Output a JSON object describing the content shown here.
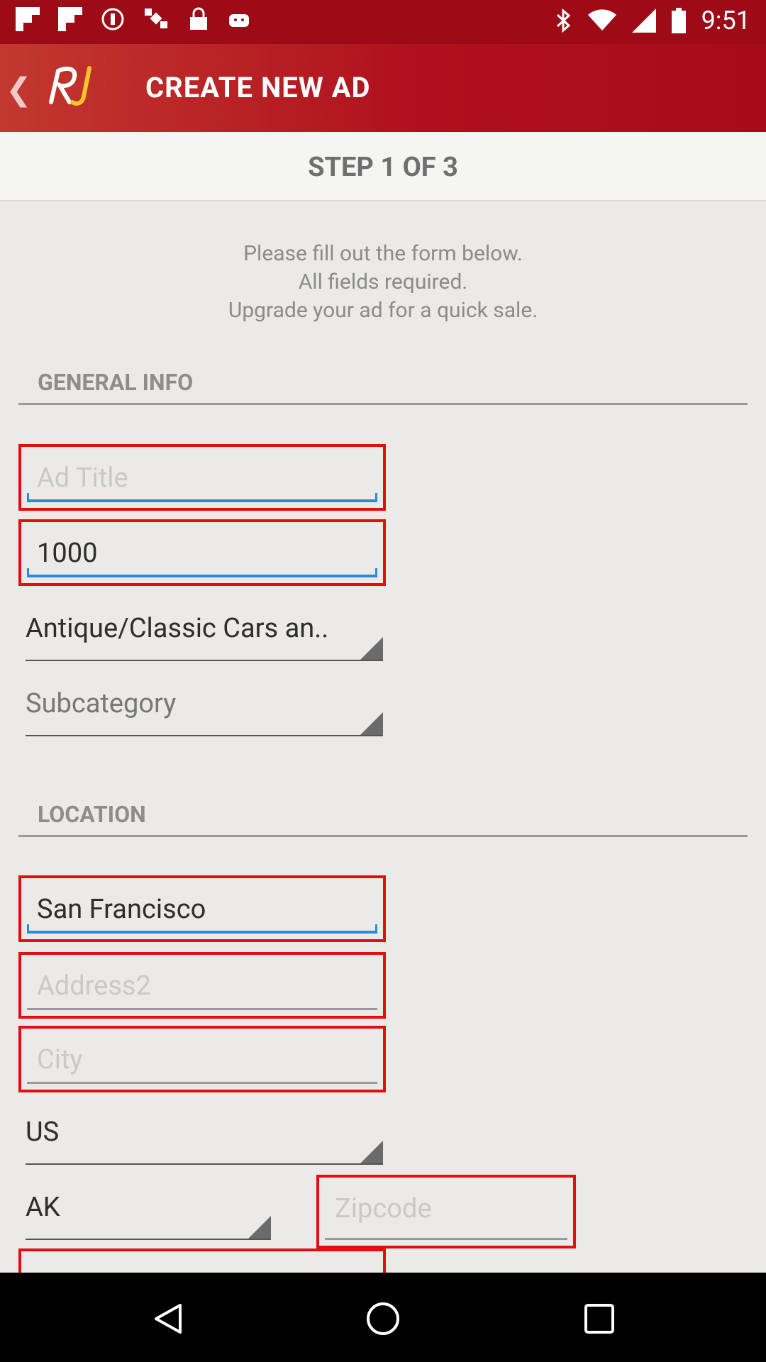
{
  "statusbar": {
    "time": "9:51",
    "left_icons": [
      "flipboard-icon",
      "flipboard-icon",
      "podcast-icon",
      "satellite-icon",
      "lock-icon",
      "android-icon"
    ],
    "right_icons": [
      "bluetooth-icon",
      "wifi-icon",
      "signal-icon",
      "battery-icon"
    ]
  },
  "appbar": {
    "title": "CREATE NEW AD",
    "logo_text": "RJ"
  },
  "step": {
    "label": "STEP 1 OF 3"
  },
  "instructions": [
    "Please fill out the form below.",
    "All fields required.",
    "Upgrade your ad for a quick sale."
  ],
  "general": {
    "header": "GENERAL INFO",
    "ad_title": {
      "value": "",
      "placeholder": "Ad Title"
    },
    "price": {
      "value": "1000",
      "placeholder": ""
    },
    "category": "Antique/Classic Cars an..",
    "subcategory": "Subcategory"
  },
  "location": {
    "header": "LOCATION",
    "address1": {
      "value": "San Francisco",
      "placeholder": ""
    },
    "address2": {
      "value": "",
      "placeholder": "Address2"
    },
    "city": {
      "value": "",
      "placeholder": "City"
    },
    "country": "US",
    "state": "AK",
    "zipcode": {
      "value": "",
      "placeholder": "Zipcode"
    }
  },
  "colors": {
    "accent": "#b0101d",
    "error_border": "#e10f10",
    "focus": "#2b8bd4"
  }
}
